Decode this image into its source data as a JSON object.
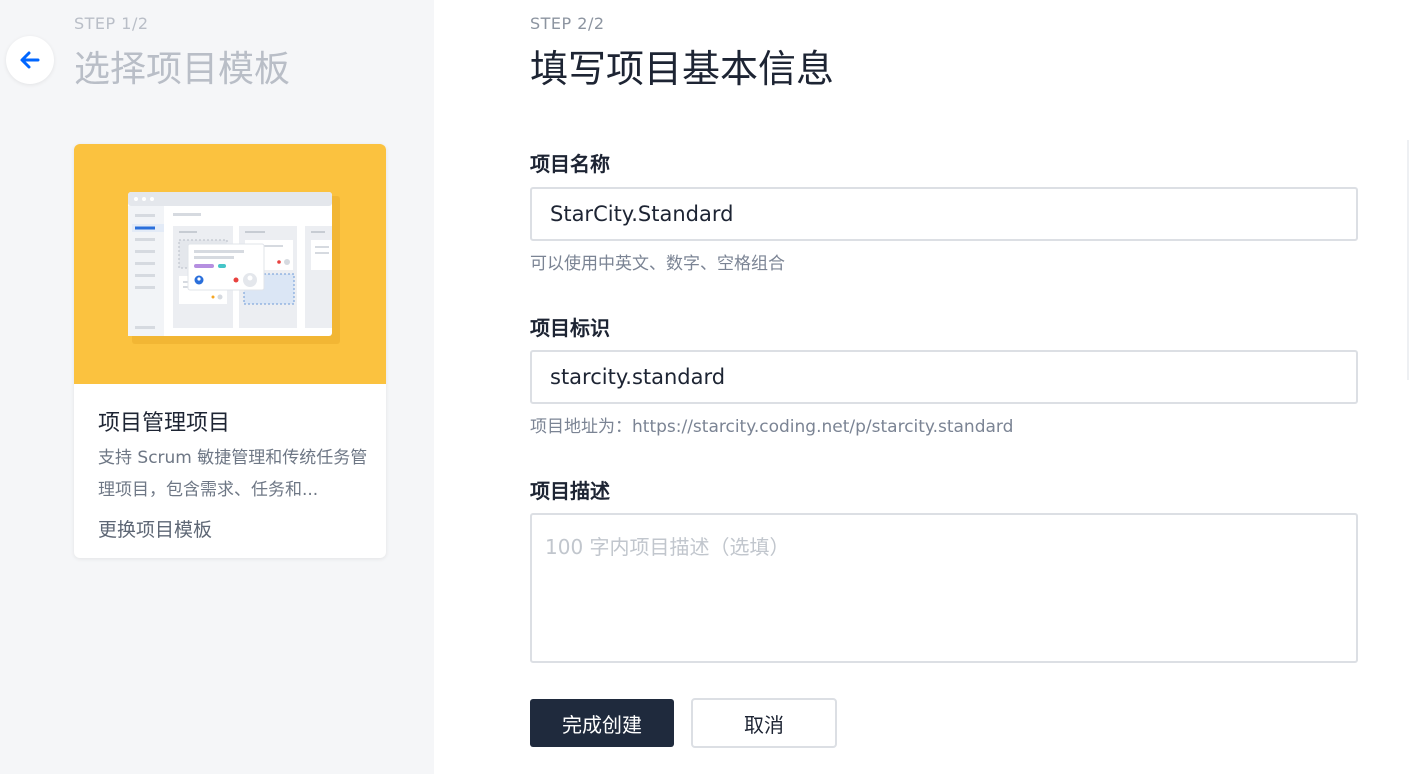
{
  "left_panel": {
    "step": "STEP 1/2",
    "title": "选择项目模板",
    "card": {
      "title": "项目管理项目",
      "description": "支持 Scrum 敏捷管理和传统任务管理项目，包含需求、任务和...",
      "change_link": "更换项目模板",
      "image_bg_color": "#fbc23f"
    }
  },
  "right_panel": {
    "step": "STEP 2/2",
    "title": "填写项目基本信息",
    "fields": {
      "name": {
        "label": "项目名称",
        "value": "StarCity.Standard",
        "hint": "可以使用中英文、数字、空格组合"
      },
      "identifier": {
        "label": "项目标识",
        "value": "starcity.standard",
        "hint": "项目地址为：https://starcity.coding.net/p/starcity.standard"
      },
      "description": {
        "label": "项目描述",
        "value": "",
        "placeholder": "100 字内项目描述（选填）"
      }
    },
    "buttons": {
      "submit": "完成创建",
      "cancel": "取消"
    }
  },
  "colors": {
    "primary_button": "#1f2a3d",
    "back_arrow": "#0066ff",
    "left_bg": "#f5f6f8"
  },
  "icons": {
    "back": "arrow-left-icon"
  }
}
